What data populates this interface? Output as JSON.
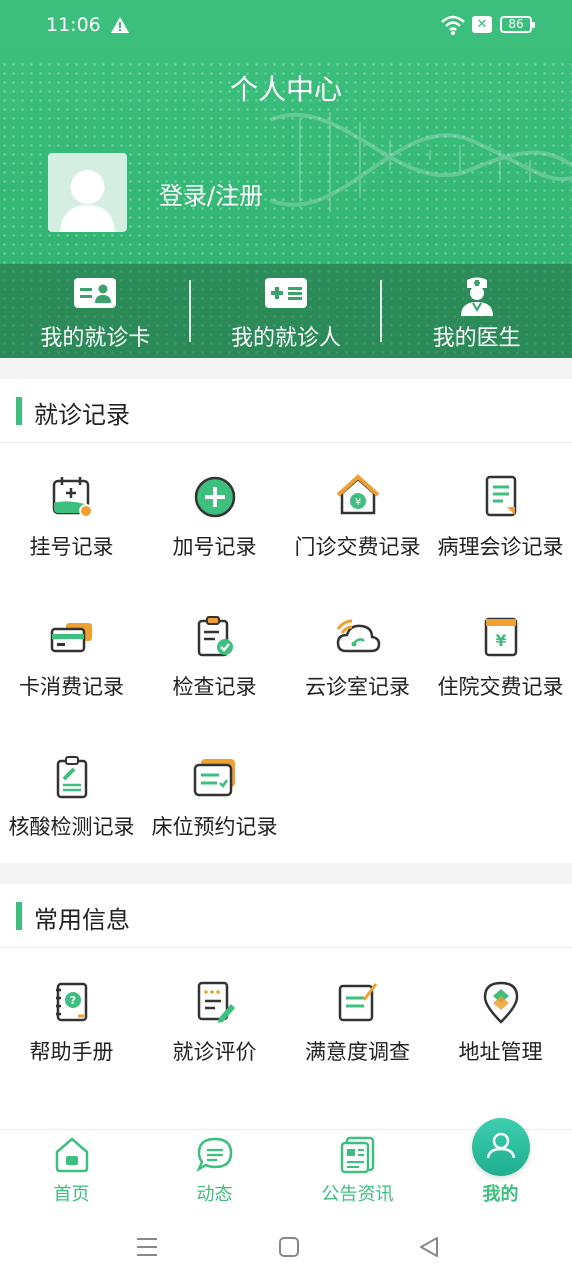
{
  "status_bar": {
    "time": "11:06",
    "battery": "86"
  },
  "header": {
    "title": "个人中心",
    "login_text": "登录/注册"
  },
  "quick_actions": [
    {
      "label": "我的就诊卡",
      "icon": "id-card-icon"
    },
    {
      "label": "我的就诊人",
      "icon": "patient-card-icon"
    },
    {
      "label": "我的医生",
      "icon": "doctor-icon"
    }
  ],
  "visit_records": {
    "title": "就诊记录",
    "items": [
      {
        "label": "挂号记录",
        "icon": "register-calendar-icon"
      },
      {
        "label": "加号记录",
        "icon": "plus-circle-icon"
      },
      {
        "label": "门诊交费记录",
        "icon": "outpatient-payment-icon"
      },
      {
        "label": "病理会诊记录",
        "icon": "pathology-document-icon"
      },
      {
        "label": "卡消费记录",
        "icon": "card-consumption-icon"
      },
      {
        "label": "检查记录",
        "icon": "clipboard-check-icon"
      },
      {
        "label": "云诊室记录",
        "icon": "cloud-clinic-icon"
      },
      {
        "label": "住院交费记录",
        "icon": "inpatient-payment-icon"
      },
      {
        "label": "核酸检测记录",
        "icon": "test-clipboard-icon"
      },
      {
        "label": "床位预约记录",
        "icon": "bed-booking-icon"
      }
    ]
  },
  "common_info": {
    "title": "常用信息",
    "items": [
      {
        "label": "帮助手册",
        "icon": "help-book-icon"
      },
      {
        "label": "就诊评价",
        "icon": "review-edit-icon"
      },
      {
        "label": "满意度调查",
        "icon": "survey-icon"
      },
      {
        "label": "地址管理",
        "icon": "location-pin-icon"
      }
    ]
  },
  "tab_bar": [
    {
      "label": "首页",
      "icon": "home-icon"
    },
    {
      "label": "动态",
      "icon": "chat-bubble-icon"
    },
    {
      "label": "公告资讯",
      "icon": "news-icon"
    },
    {
      "label": "我的",
      "icon": "user-icon",
      "active": true
    }
  ],
  "colors": {
    "brand_green": "#3dbf7d",
    "accent_orange": "#f0a030",
    "text": "#222222"
  }
}
